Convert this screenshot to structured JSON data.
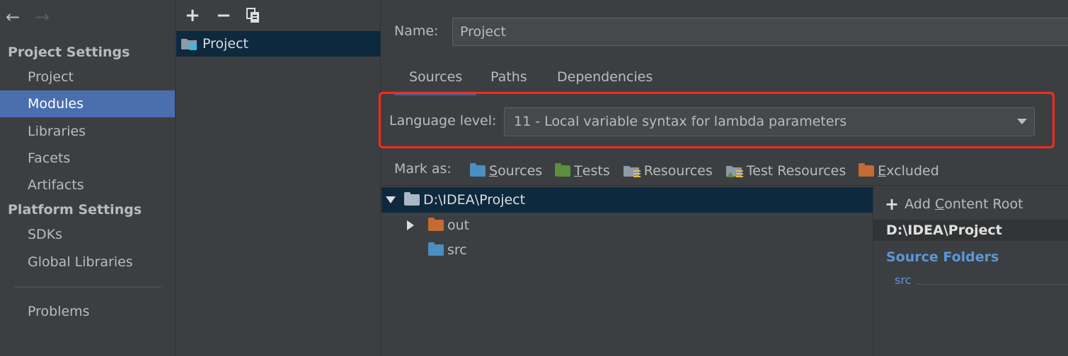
{
  "sidebar": {
    "back_icon": "←",
    "forward_icon": "→",
    "project_settings_header": "Project Settings",
    "project_items": [
      "Project",
      "Modules",
      "Libraries",
      "Facets",
      "Artifacts"
    ],
    "selected_item": "Modules",
    "platform_settings_header": "Platform Settings",
    "platform_items": [
      "SDKs",
      "Global Libraries"
    ],
    "problems": "Problems"
  },
  "module_list": {
    "toolbar": {
      "add": "+",
      "remove": "−",
      "copy": "⧉"
    },
    "modules": [
      {
        "name": "Project",
        "icon": "module-folder-icon"
      }
    ]
  },
  "module_editor": {
    "name_label": "Name:",
    "name_value": "Project",
    "tabs": [
      "Sources",
      "Paths",
      "Dependencies"
    ],
    "active_tab": "Sources",
    "language_level_label": "Language level:",
    "language_level_value": "11 - Local variable syntax for lambda parameters",
    "mark_as_label": "Mark as:",
    "mark_as": [
      {
        "mnemonic": "S",
        "rest": "ources",
        "color": "#4a8fc2"
      },
      {
        "mnemonic": "T",
        "rest": "ests",
        "color": "#5c8e3c"
      },
      {
        "mnemonic": "",
        "rest": "Resources",
        "color": "#8d9ba8"
      },
      {
        "mnemonic": "",
        "rest": "Test Resources",
        "color": "#8d9ba8"
      },
      {
        "mnemonic": "E",
        "rest": "xcluded",
        "color": "#c46a34"
      }
    ],
    "tree": {
      "root": "D:\\IDEA\\Project",
      "children": [
        {
          "name": "out",
          "color": "#c46a34"
        },
        {
          "name": "src",
          "color": "#4a8fc2"
        }
      ]
    },
    "content_root_panel": {
      "add_content_root_prefix": "Add ",
      "add_content_root_mnemonic": "C",
      "add_content_root_rest": "ontent Root",
      "path": "D:\\IDEA\\Project",
      "source_folders_header": "Source Folders",
      "source_folder": "src"
    }
  },
  "colors": {
    "selection": "#4b6eaf",
    "tree_selection": "#0d293e",
    "highlight": "#ff2a1f",
    "link": "#5c97d8"
  }
}
